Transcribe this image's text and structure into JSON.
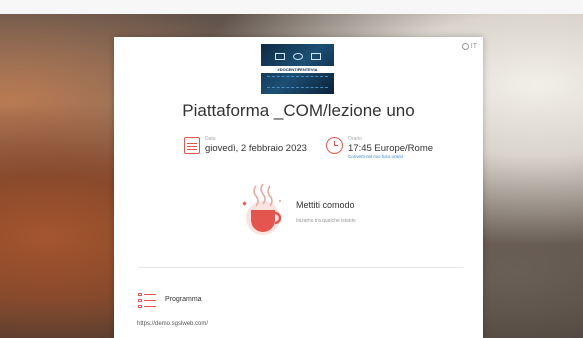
{
  "language": {
    "label": "IT"
  },
  "event": {
    "image_label": "#DOCENTIFENTEVIA",
    "title": "Piattaforma _COM/lezione uno"
  },
  "date": {
    "label": "Data",
    "value": "giovedì, 2 febbraio 2023"
  },
  "time": {
    "label": "Orario",
    "value": "17:45 Europe/Rome",
    "convert_link": "Converti nel mio fuso orario"
  },
  "status": {
    "title": "Mettiti comodo",
    "subtitle": "Inizamo tra qualche istante"
  },
  "program": {
    "label": "Programma",
    "url": "https://demo.sgslweb.com/"
  },
  "colors": {
    "accent": "#e5554f",
    "link": "#3a86d6"
  }
}
